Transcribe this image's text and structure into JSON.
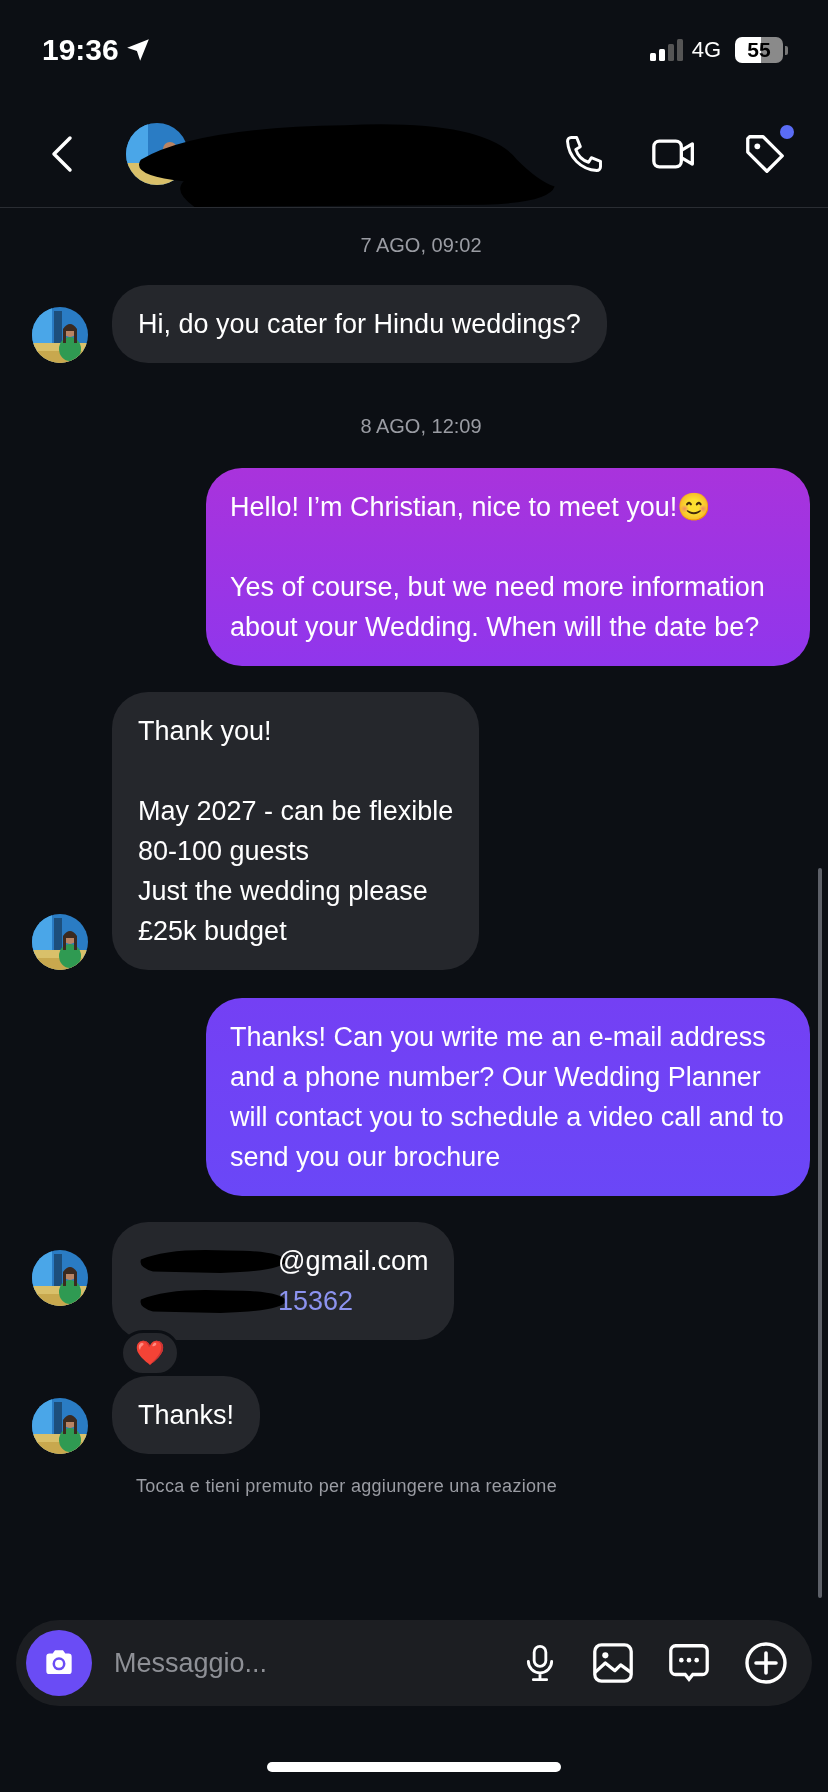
{
  "status_bar": {
    "time": "19:36",
    "network": "4G",
    "battery": "55"
  },
  "header": {
    "tag_badge": true
  },
  "messages": [
    {
      "kind": "date",
      "text": "7 AGO, 09:02"
    },
    {
      "kind": "received",
      "lines": [
        {
          "text": "Hi, do you cater for Hindu weddings?",
          "kind": "text"
        }
      ]
    },
    {
      "kind": "date",
      "text": "8 AGO, 12:09"
    },
    {
      "kind": "sent",
      "lines": [
        {
          "text": "Hello! I’m Christian, nice to meet you!😊\n\nYes of course, but we need more information about your Wedding. When will the date be?",
          "kind": "text"
        }
      ]
    },
    {
      "kind": "received",
      "lines": [
        {
          "text": "Thank you!\n\nMay 2027 - can be flexible\n80-100 guests\nJust the wedding please\n£25k budget",
          "kind": "text"
        }
      ]
    },
    {
      "kind": "sent",
      "lines": [
        {
          "text": "Thanks! Can you write me an e-mail address and a phone number? Our Wedding Planner will contact you to schedule a video call and to send you our brochure",
          "kind": "text"
        }
      ]
    },
    {
      "kind": "received",
      "lines": [
        {
          "text": "@gmail.com",
          "kind": "redacted_text"
        },
        {
          "text": "15362",
          "kind": "redacted_link"
        }
      ],
      "reaction": "❤️"
    },
    {
      "kind": "received",
      "lines": [
        {
          "text": "Thanks!",
          "kind": "text"
        }
      ]
    },
    {
      "kind": "hint",
      "text": "Tocca e tieni premuto per aggiungere una reazione"
    }
  ],
  "composer": {
    "placeholder": "Messaggio..."
  }
}
